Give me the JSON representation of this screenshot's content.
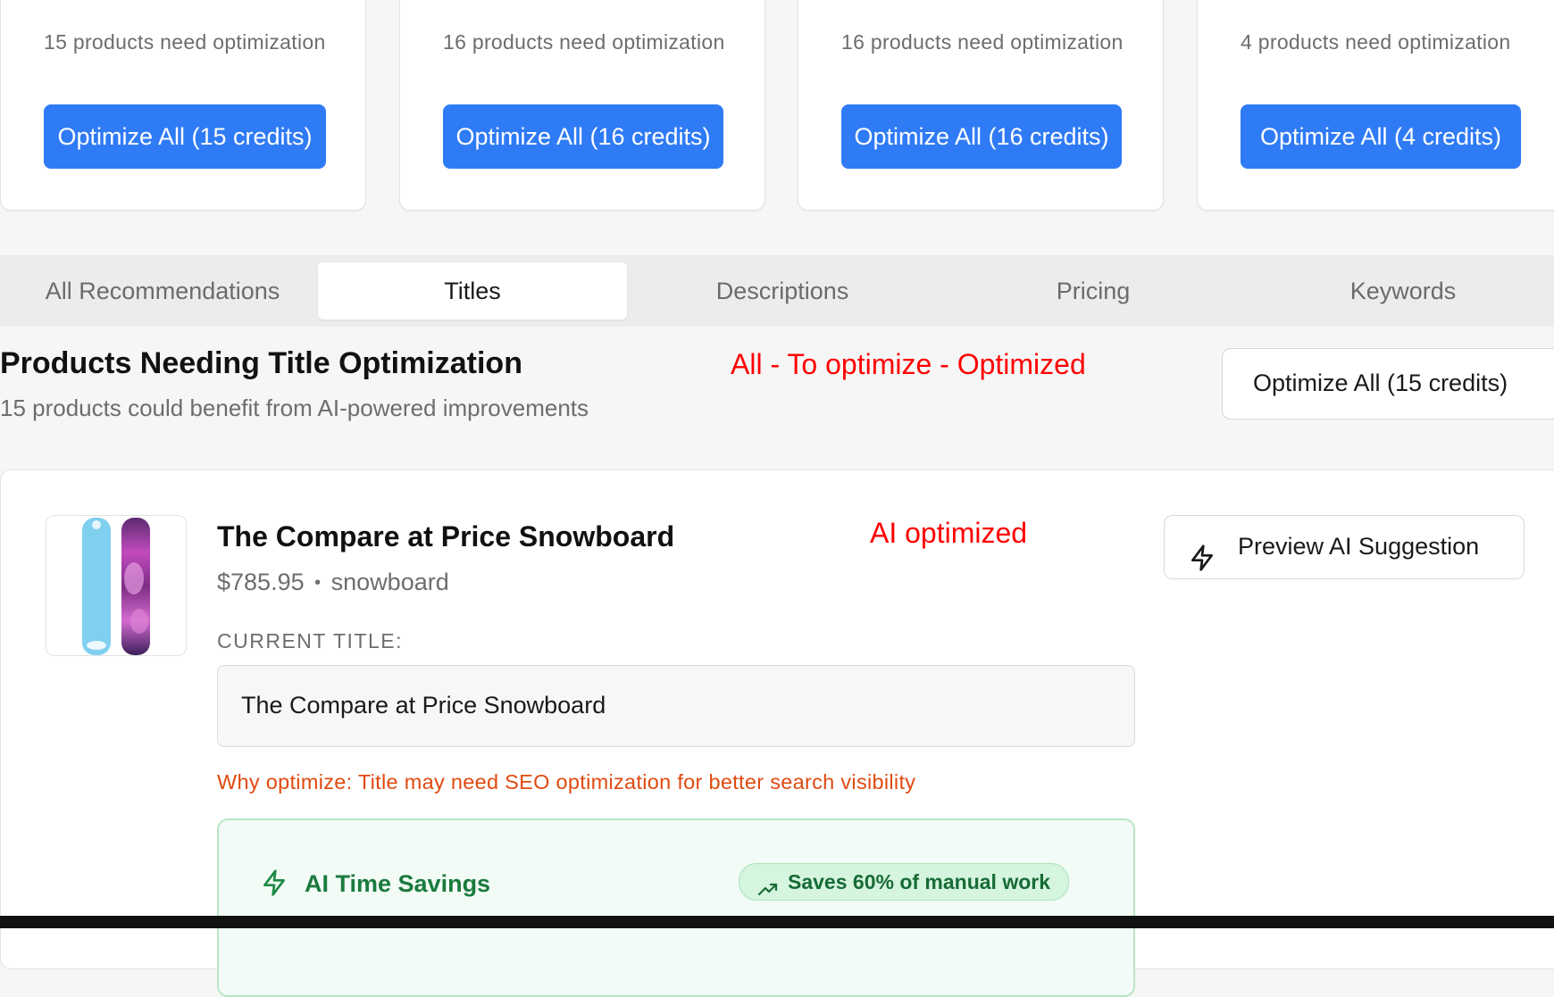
{
  "summary_cards": [
    {
      "need": "15 products need optimization",
      "button": "Optimize All (15 credits)"
    },
    {
      "need": "16 products need optimization",
      "button": "Optimize All (16 credits)"
    },
    {
      "need": "16 products need optimization",
      "button": "Optimize All (16 credits)"
    },
    {
      "need": "4 products need optimization",
      "button": "Optimize All (4 credits)"
    }
  ],
  "tabs": [
    {
      "label": "All Recommendations",
      "active": false
    },
    {
      "label": "Titles",
      "active": true
    },
    {
      "label": "Descriptions",
      "active": false
    },
    {
      "label": "Pricing",
      "active": false
    },
    {
      "label": "Keywords",
      "active": false
    }
  ],
  "section": {
    "title": "Products Needing Title Optimization",
    "subtitle": "15 products could benefit from AI-powered improvements",
    "optimize_all": "Optimize All (15 credits)"
  },
  "annotations": {
    "filter_note": "All - To optimize - Optimized",
    "status_note": "AI optimized"
  },
  "product": {
    "name": "The Compare at Price Snowboard",
    "price": "$785.95",
    "separator": "•",
    "type": "snowboard",
    "current_title_label": "CURRENT TITLE:",
    "current_title": "The Compare at Price Snowboard",
    "why_label": "Why optimize:",
    "why_text": "Title may need SEO optimization for better search visibility",
    "preview_button": "Preview AI Suggestion"
  },
  "savings": {
    "title": "AI Time Savings",
    "badge": "Saves 60% of manual work"
  },
  "colors": {
    "primary": "#2f7bf6",
    "annotation_red": "#ff0000",
    "why_orange": "#e04a0f",
    "success_green": "#1a7a3e"
  },
  "icons": {
    "preview": "lightning-icon",
    "savings": "lightning-icon",
    "badge": "trending-up-icon"
  }
}
